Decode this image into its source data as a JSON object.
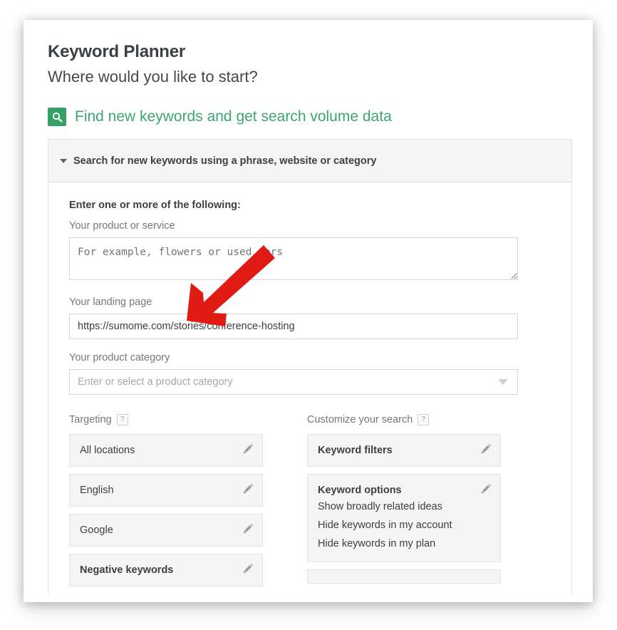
{
  "app": {
    "title": "Keyword Planner",
    "subtitle": "Where would you like to start?"
  },
  "section": {
    "icon": "search-icon",
    "heading": "Find new keywords and get search volume data",
    "accent_color": "#3ea570",
    "icon_bg_color": "#34a267"
  },
  "panel": {
    "caret": "chevron-down-icon",
    "header_label": "Search for new keywords using a phrase, website or category"
  },
  "form": {
    "legend": "Enter one or more of the following:",
    "product_or_service": {
      "label": "Your product or service",
      "placeholder": "For example, flowers or used cars",
      "value": ""
    },
    "landing_page": {
      "label": "Your landing page",
      "placeholder": "",
      "value": "https://sumome.com/stories/conference-hosting"
    },
    "product_category": {
      "label": "Your product category",
      "placeholder": "Enter or select a product category",
      "value": ""
    }
  },
  "targeting": {
    "heading": "Targeting",
    "help": "?",
    "items": [
      {
        "label": "All locations",
        "bold": false,
        "edit_icon": "pencil-icon"
      },
      {
        "label": "English",
        "bold": false,
        "edit_icon": "pencil-icon"
      },
      {
        "label": "Google",
        "bold": false,
        "edit_icon": "pencil-icon"
      },
      {
        "label": "Negative keywords",
        "bold": true,
        "edit_icon": "pencil-icon"
      }
    ]
  },
  "customize": {
    "heading": "Customize your search",
    "help": "?",
    "items": [
      {
        "label": "Keyword filters",
        "bold": true,
        "edit_icon": "pencil-icon",
        "sublines": []
      },
      {
        "label": "Keyword options",
        "bold": true,
        "edit_icon": "pencil-icon",
        "sublines": [
          "Show broadly related ideas",
          "Hide keywords in my account",
          "Hide keywords in my plan"
        ]
      }
    ]
  },
  "annotation": {
    "arrow": "red-arrow-pointing-down-left",
    "color": "#e01b14"
  }
}
